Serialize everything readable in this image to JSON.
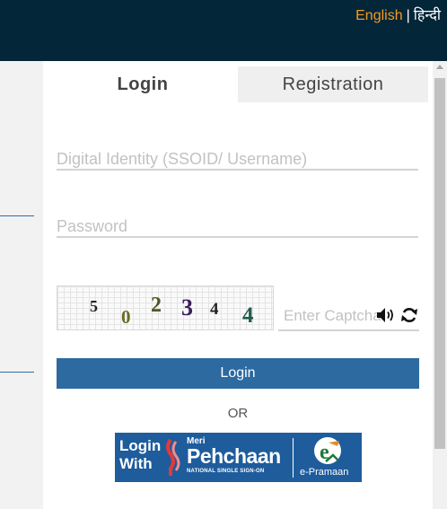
{
  "header": {
    "lang_english": "English",
    "lang_separator": "|",
    "lang_hindi": "हिन्दी"
  },
  "tabs": {
    "login": "Login",
    "registration": "Registration"
  },
  "form": {
    "ssoid_placeholder": "Digital Identity (SSOID/ Username)",
    "password_placeholder": "Password",
    "captcha_placeholder": "Enter Captcha",
    "captcha_digits": [
      "5",
      "0",
      "2",
      "3",
      "4",
      "4"
    ],
    "login_button": "Login",
    "or_text": "OR"
  },
  "banner": {
    "login": "Login",
    "with": "With",
    "meri": "Meri",
    "pehchaan": "Pehchaan",
    "tagline": "NATIONAL SINGLE SIGN-ON",
    "epramaan": "e-Pramaan"
  },
  "colors": {
    "topbar": "#032638",
    "accent_orange": "#f59a23",
    "button_blue": "#2c6aa0",
    "captcha_digit_colors": [
      "#222222",
      "#6b6b2a",
      "#4a5a1f",
      "#3a1f5c",
      "#222222",
      "#1f5a4a"
    ]
  },
  "icons": {
    "speaker": "speaker-icon",
    "refresh": "refresh-icon"
  }
}
